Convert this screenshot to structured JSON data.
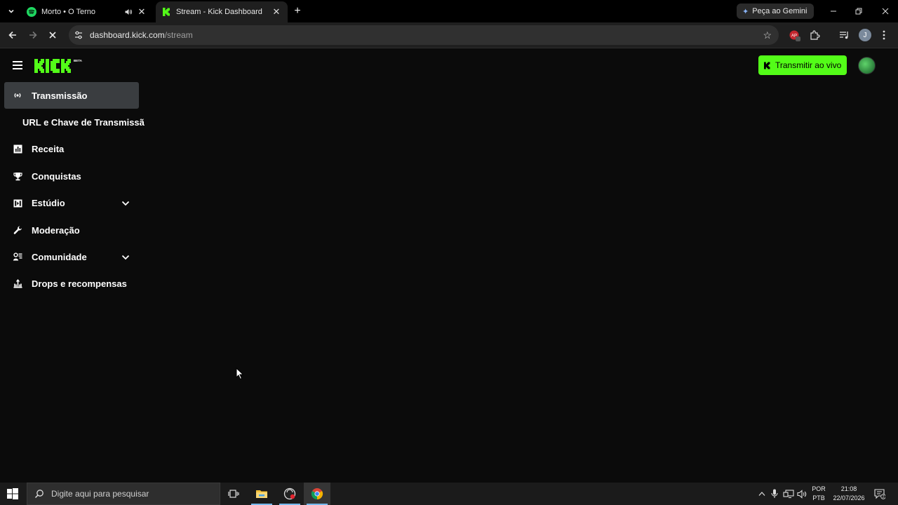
{
  "browser": {
    "tabs": [
      {
        "title": "Morto • O Terno",
        "favicon": "spotify-icon",
        "playing_audio": true
      },
      {
        "title": "Stream - Kick Dashboard",
        "favicon": "kick-icon",
        "active": true
      }
    ],
    "gemini_label": "Peça ao Gemini",
    "address": {
      "host": "dashboard.kick.com",
      "path": "/stream"
    },
    "profile_initial": "J",
    "extension_badge": "1"
  },
  "kick": {
    "logo_text": "KICK",
    "logo_badge": "BETA",
    "live_button_label": "Transmitir ao vivo",
    "brand_color": "#53fc18",
    "sidebar": {
      "items": [
        {
          "label": "Transmissão",
          "icon": "broadcast-icon",
          "active": true
        },
        {
          "label": "URL e Chave de Transmissão",
          "sub": true
        },
        {
          "label": "Receita",
          "icon": "chart-icon"
        },
        {
          "label": "Conquistas",
          "icon": "trophy-icon"
        },
        {
          "label": "Estúdio",
          "icon": "studio-icon",
          "expandable": true
        },
        {
          "label": "Moderação",
          "icon": "wrench-icon"
        },
        {
          "label": "Comunidade",
          "icon": "community-icon",
          "expandable": true
        },
        {
          "label": "Drops e recompensas",
          "icon": "gift-icon"
        }
      ]
    }
  },
  "taskbar": {
    "search_placeholder": "Digite aqui para pesquisar",
    "language": [
      "POR",
      "PTB"
    ],
    "time": "21:08",
    "date": "22/07/2026",
    "notifications": "2"
  }
}
